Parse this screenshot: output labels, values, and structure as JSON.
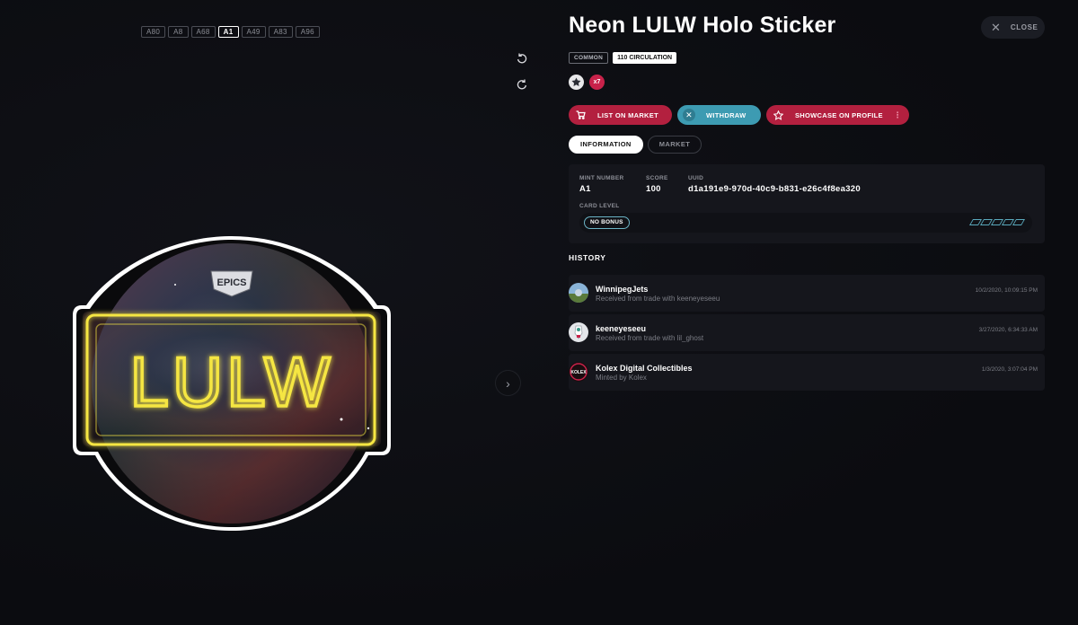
{
  "mint_tabs": [
    {
      "label": "A80",
      "active": false
    },
    {
      "label": "A8",
      "active": false
    },
    {
      "label": "A68",
      "active": false
    },
    {
      "label": "A1",
      "active": true
    },
    {
      "label": "A49",
      "active": false
    },
    {
      "label": "A83",
      "active": false
    },
    {
      "label": "A96",
      "active": false
    }
  ],
  "card": {
    "title": "Neon LULW Holo Sticker",
    "rarity": "COMMON",
    "circulation": "110 CIRCULATION",
    "count": "x7",
    "sticker_text": "LULW",
    "brand_logo": "EPICS"
  },
  "close": {
    "label": "CLOSE"
  },
  "actions": {
    "list": "LIST ON MARKET",
    "withdraw": "WITHDRAW",
    "showcase": "SHOWCASE ON PROFILE"
  },
  "tabs": {
    "information": "INFORMATION",
    "market": "MARKET"
  },
  "info": {
    "mint_label": "MINT NUMBER",
    "mint_value": "A1",
    "score_label": "SCORE",
    "score_value": "100",
    "uuid_label": "UUID",
    "uuid_value": "d1a191e9-970d-40c9-b831-e26c4f8ea320",
    "card_level_label": "CARD LEVEL",
    "bonus": "NO BONUS",
    "level_pips": 5
  },
  "history": {
    "heading": "HISTORY",
    "rows": [
      {
        "name": "WinnipegJets",
        "desc": "Received from trade with keeneyeseeu",
        "time": "10/2/2020, 10:09:15 PM"
      },
      {
        "name": "keeneyeseeu",
        "desc": "Received from trade with lil_ghost",
        "time": "3/27/2020, 6:34:33 AM"
      },
      {
        "name": "Kolex Digital Collectibles",
        "desc": "Minted by Kolex",
        "time": "1/3/2020, 3:07:04 PM",
        "avatar_text": "KOLEX"
      }
    ]
  },
  "colors": {
    "accent_red": "#b3203f",
    "accent_teal": "#3d9bb2",
    "neon_yellow": "#f5e642",
    "background": "#0b0c10"
  }
}
